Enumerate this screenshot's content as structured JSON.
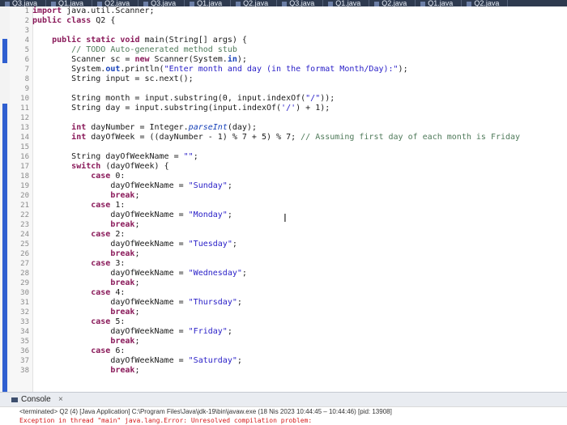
{
  "tabs": [
    {
      "label": "Q3.java"
    },
    {
      "label": "Q1.java"
    },
    {
      "label": "Q2.java"
    },
    {
      "label": "Q3.java"
    },
    {
      "label": "Q1.java"
    },
    {
      "label": "Q2.java"
    },
    {
      "label": "Q3.java"
    },
    {
      "label": "Q1.java"
    },
    {
      "label": "Q2.java"
    },
    {
      "label": "Q1.java"
    },
    {
      "label": "Q2.java"
    }
  ],
  "editor": {
    "lines": [
      {
        "n": "1",
        "text": "import java.util.Scanner;"
      },
      {
        "n": "2",
        "text": "public class Q2 {"
      },
      {
        "n": "3",
        "text": ""
      },
      {
        "n": "4",
        "text": "    public static void main(String[] args) {"
      },
      {
        "n": "5",
        "text": "        // TODO Auto-generated method stub"
      },
      {
        "n": "6",
        "text": "        Scanner sc = new Scanner(System.in);"
      },
      {
        "n": "7",
        "text": "        System.out.println(\"Enter month and day (in the format Month/Day):\");"
      },
      {
        "n": "8",
        "text": "        String input = sc.next();"
      },
      {
        "n": "9",
        "text": ""
      },
      {
        "n": "10",
        "text": "        String month = input.substring(0, input.indexOf(\"/\"));"
      },
      {
        "n": "11",
        "text": "        String day = input.substring(input.indexOf('/') + 1);"
      },
      {
        "n": "12",
        "text": ""
      },
      {
        "n": "13",
        "text": "        int dayNumber = Integer.parseInt(day);"
      },
      {
        "n": "14",
        "text": "        int dayOfWeek = ((dayNumber - 1) % 7 + 5) % 7; // Assuming first day of each month is Friday"
      },
      {
        "n": "15",
        "text": ""
      },
      {
        "n": "16",
        "text": "        String dayOfWeekName = \"\";"
      },
      {
        "n": "17",
        "text": "        switch (dayOfWeek) {"
      },
      {
        "n": "18",
        "text": "            case 0:"
      },
      {
        "n": "19",
        "text": "                dayOfWeekName = \"Sunday\";"
      },
      {
        "n": "20",
        "text": "                break;"
      },
      {
        "n": "21",
        "text": "            case 1:"
      },
      {
        "n": "22",
        "text": "                dayOfWeekName = \"Monday\";"
      },
      {
        "n": "23",
        "text": "                break;"
      },
      {
        "n": "24",
        "text": "            case 2:"
      },
      {
        "n": "25",
        "text": "                dayOfWeekName = \"Tuesday\";"
      },
      {
        "n": "26",
        "text": "                break;"
      },
      {
        "n": "27",
        "text": "            case 3:"
      },
      {
        "n": "28",
        "text": "                dayOfWeekName = \"Wednesday\";"
      },
      {
        "n": "29",
        "text": "                break;"
      },
      {
        "n": "30",
        "text": "            case 4:"
      },
      {
        "n": "31",
        "text": "                dayOfWeekName = \"Thursday\";"
      },
      {
        "n": "32",
        "text": "                break;"
      },
      {
        "n": "33",
        "text": "            case 5:"
      },
      {
        "n": "34",
        "text": "                dayOfWeekName = \"Friday\";"
      },
      {
        "n": "35",
        "text": "                break;"
      },
      {
        "n": "36",
        "text": "            case 6:"
      },
      {
        "n": "37",
        "text": "                dayOfWeekName = \"Saturday\";"
      },
      {
        "n": "38",
        "text": "                break;"
      }
    ]
  },
  "console": {
    "tab_label": "Console",
    "close_glyph": "×",
    "status": "<terminated> Q2 (4) [Java Application] C:\\Program Files\\Java\\jdk-19\\bin\\javaw.exe (18 Nis 2023 10:44:45 – 10:44:46) [pid: 13908]",
    "error": "Exception in thread \"main\" java.lang.Error: Unresolved compilation problem:"
  },
  "colors": {
    "tabbar": "#2e3a4f",
    "keyword": "#8a1a5a",
    "string": "#2a20c8",
    "comment": "#4f7a5a",
    "error": "#d21b1b",
    "gutter_marker": "#2f5fd0"
  },
  "icons": [
    "java-file-icon",
    "console-icon",
    "close-icon",
    "ibeam-cursor-icon"
  ]
}
